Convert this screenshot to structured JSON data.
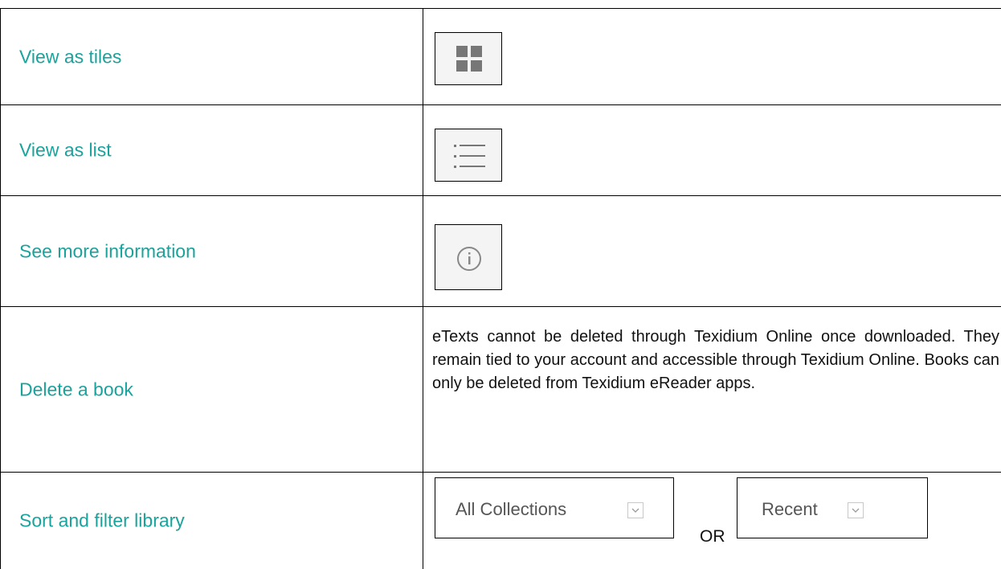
{
  "rows": [
    {
      "label": "View as tiles",
      "icon": "grid-icon"
    },
    {
      "label": "View as list",
      "icon": "list-icon"
    },
    {
      "label": "See more information",
      "icon": "info-icon"
    },
    {
      "label": "Delete a book",
      "description": "eTexts cannot be deleted through Texidium Online once downloaded. They remain tied to your account and accessible through Texidium Online. Books can only be deleted from Texidium eReader apps."
    },
    {
      "label": "Sort and filter library",
      "collections_select": "All Collections",
      "separator": "OR",
      "sort_select": "Recent",
      "dropdown_icon": "chevron-down-icon"
    }
  ],
  "colors": {
    "label": "#1aa39c",
    "border": "#000000",
    "icon": "#777777"
  }
}
